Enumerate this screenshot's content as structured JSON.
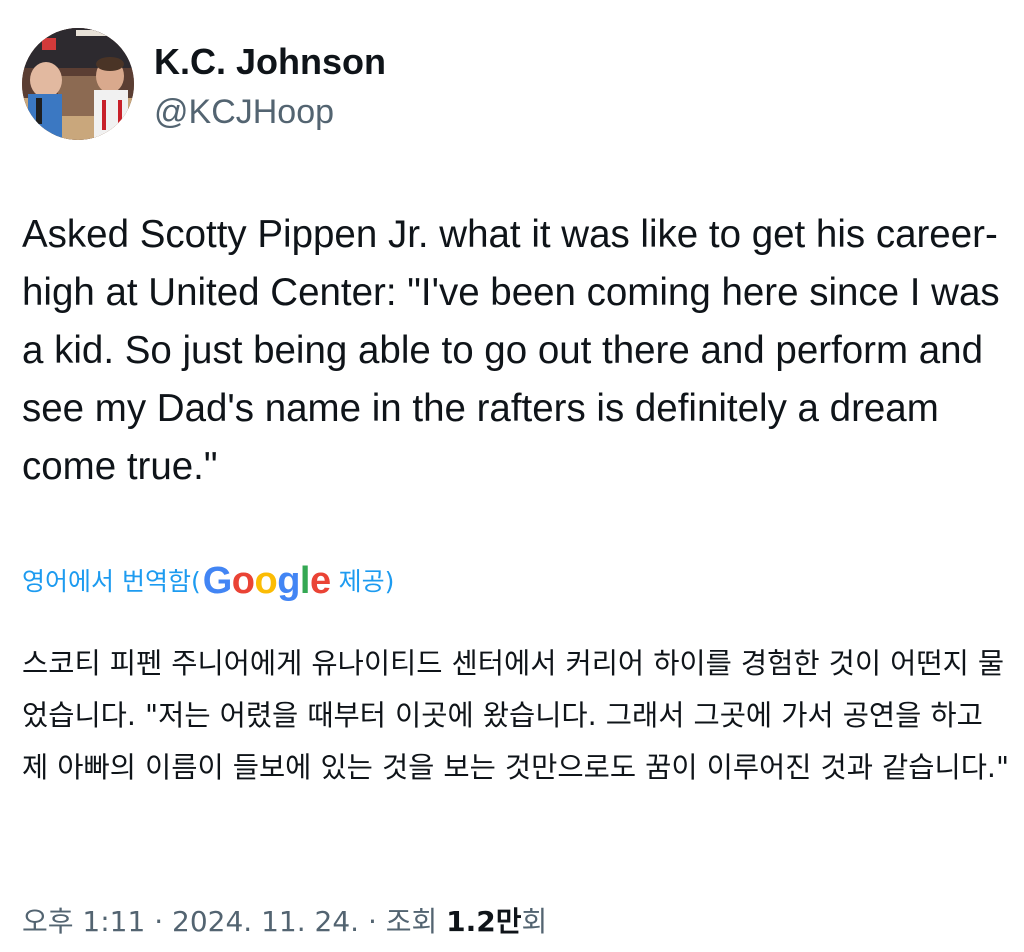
{
  "author": {
    "display_name": "K.C. Johnson",
    "handle": "@KCJHoop"
  },
  "tweet": {
    "text": "Asked Scotty Pippen Jr. what it was like to get his career-high at United Center: \"I've been coming here since I was a kid. So just being able to go out there and perform and see my Dad's name in the rafters is definitely a dream come true.\""
  },
  "translation": {
    "label_prefix": "영어에서 번역함(",
    "provider": "Google",
    "label_suffix": " 제공)",
    "text": "스코티 피펜 주니어에게 유나이티드 센터에서 커리어 하이를 경험한 것이 어떤지 물었습니다. \"저는 어렸을 때부터 이곳에 왔습니다. 그래서 그곳에 가서 공연을 하고 제 아빠의 이름이 들보에 있는 것을 보는 것만으로도 꿈이 이루어진 것과 같습니다.\""
  },
  "meta": {
    "time": "오후 1:11",
    "separator": " · ",
    "date": "2024. 11. 24.",
    "views_label": "조회 ",
    "views_count": "1.2만",
    "views_suffix": "회"
  },
  "colors": {
    "link": "#1d9bf0",
    "text_primary": "#0f1419",
    "text_secondary": "#536471",
    "google_blue": "#4285f4",
    "google_red": "#ea4335",
    "google_yellow": "#fbbc05",
    "google_green": "#34a853"
  }
}
